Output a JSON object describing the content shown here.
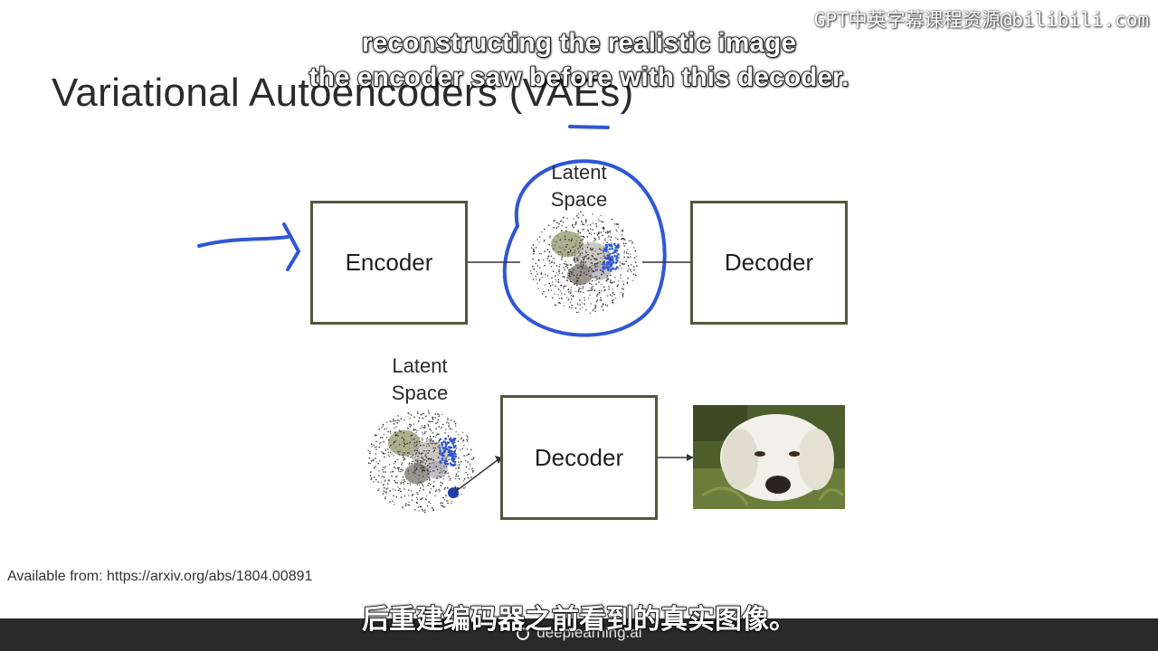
{
  "slide": {
    "title": "Variational Autoencoders (VAEs)",
    "top_diagram": {
      "encoder_label": "Encoder",
      "latent_label_line1": "Latent",
      "latent_label_line2": "Space",
      "decoder_label": "Decoder"
    },
    "bottom_diagram": {
      "latent_label_line1": "Latent",
      "latent_label_line2": "Space",
      "decoder_label": "Decoder",
      "output_image": "dog-photo"
    },
    "citation": "Available from: https://arxiv.org/abs/1804.00891"
  },
  "subtitles": {
    "english_line1": "reconstructing the realistic image",
    "english_line2": "the encoder saw before with this decoder.",
    "chinese": "后重建编码器之前看到的真实图像。"
  },
  "watermark": "GPT中英字幕课程资源@bilibili.com",
  "footer": {
    "brand": "deeplearning.ai"
  },
  "colors": {
    "box_border": "#55553a",
    "annotation_ink": "#2f56d6",
    "footer_bg": "#2a2a2a"
  }
}
